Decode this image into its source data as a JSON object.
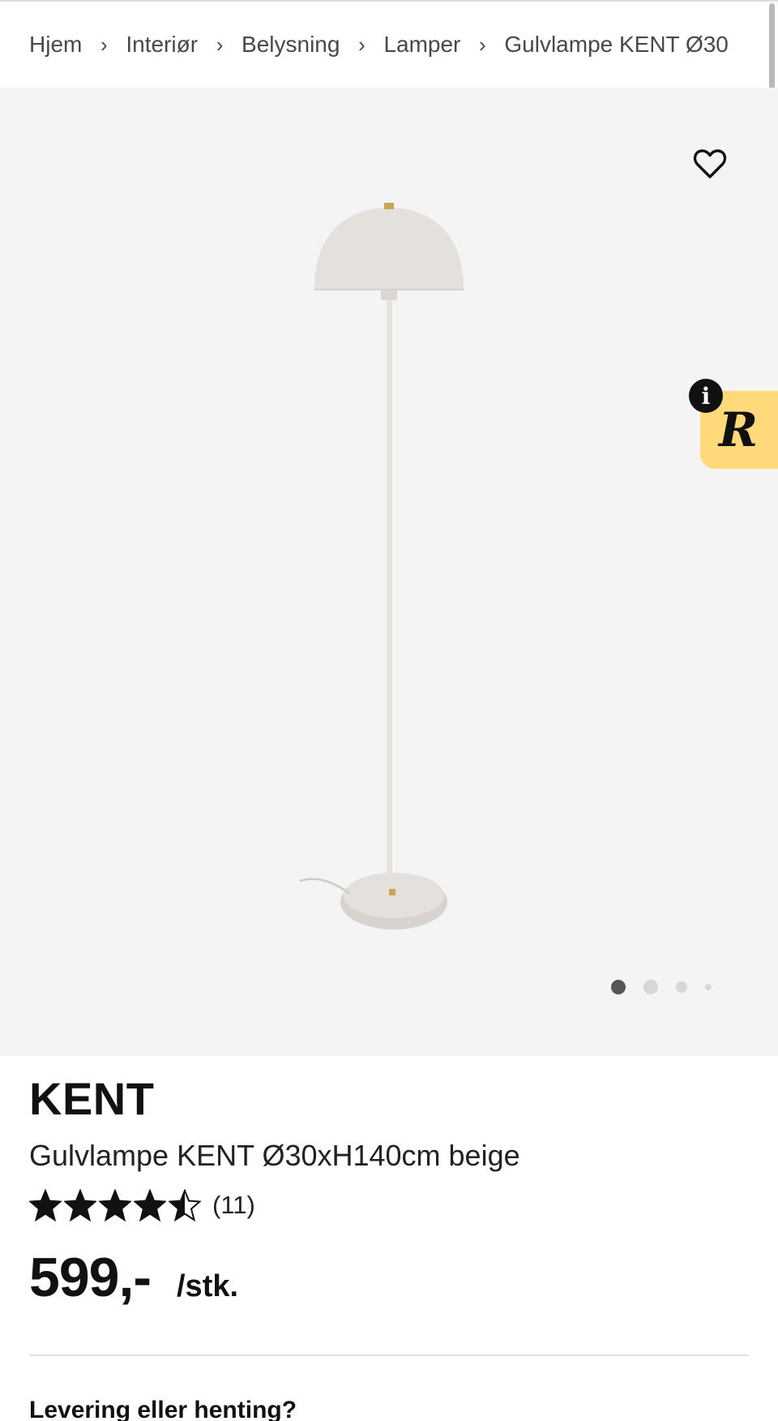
{
  "breadcrumb": {
    "items": [
      "Hjem",
      "Interiør",
      "Belysning",
      "Lamper",
      "Gulvlampe KENT Ø30"
    ],
    "separator": "›"
  },
  "gallery": {
    "background": "#f4f4f4",
    "favorite_icon": "heart-outline-icon",
    "image_alt": "floor-lamp-product-photo",
    "carousel_dots": 4,
    "active_slide": 1
  },
  "review_widget": {
    "logo_letter": "R",
    "info_label": "i",
    "color": "#ffd97a"
  },
  "product": {
    "brand": "KENT",
    "description": "Gulvlampe KENT Ø30xH140cm beige",
    "rating": 4.5,
    "rating_max": 5,
    "rating_count": "(11)",
    "price": "599,-",
    "unit": "/stk."
  },
  "delivery": {
    "heading": "Levering eller henting?"
  }
}
